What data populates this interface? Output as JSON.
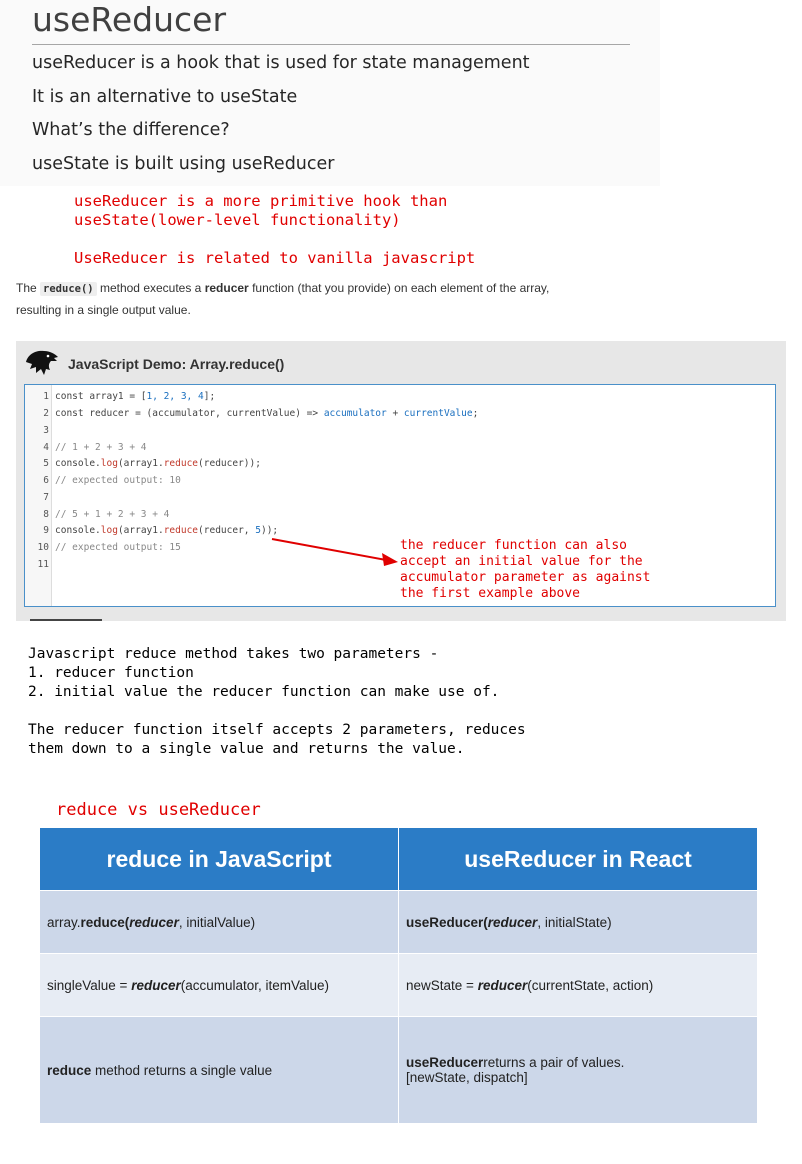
{
  "slide": {
    "title": "useReducer",
    "lines": [
      "useReducer is a hook that is used for state management",
      "It is an alternative to useState",
      "What’s the difference?",
      "useState is built using useReducer"
    ]
  },
  "red_notes": {
    "primitive_line1": "useReducer is a more primitive hook than",
    "primitive_line2": "useState(lower-level functionality)",
    "vanilla": "UseReducer is related to vanilla javascript"
  },
  "mdn": {
    "line1_the": "The",
    "line1_code": "reduce()",
    "line1_mid": "method executes a",
    "line1_bold": "reducer",
    "line1_end": "function (that you provide) on each element of the array,",
    "line2": "resulting in a single output value."
  },
  "demo": {
    "title": "JavaScript Demo: Array.reduce()",
    "line_numbers": [
      "1",
      "2",
      "3",
      "4",
      "5",
      "6",
      "7",
      "8",
      "9",
      "10",
      "11"
    ],
    "code": {
      "l1_a": "const array1 = [",
      "l1_nums": "1, 2, 3, 4",
      "l1_b": "];",
      "l2_a": "const reducer = (accumulator, currentValue) => ",
      "l2_b": "accumulator",
      "l2_c": " + ",
      "l2_d": "currentValue",
      "l2_e": ";",
      "l4": "// 1 + 2 + 3 + 4",
      "l5_a": "console.",
      "l5_b": "log",
      "l5_c": "(array1.",
      "l5_d": "reduce",
      "l5_e": "(reducer));",
      "l6": "// expected output: 10",
      "l8": "// 5 + 1 + 2 + 3 + 4",
      "l9_a": "console.",
      "l9_b": "log",
      "l9_c": "(array1.",
      "l9_d": "reduce",
      "l9_e": "(reducer, ",
      "l9_f": "5",
      "l9_g": "));",
      "l10": "// expected output: 15"
    },
    "annotation": [
      "the reducer function can also",
      "accept an initial value for the",
      "accumulator parameter as against",
      "the first example above"
    ]
  },
  "notes": {
    "l1": "Javascript reduce method takes two parameters -",
    "l2": "1. reducer function",
    "l3": "2. initial value the reducer function can make use of.",
    "l4": "The reducer function itself accepts 2 parameters, reduces",
    "l5": "them down to a single value and returns the value."
  },
  "comparison": {
    "heading": "reduce vs useReducer",
    "col1": "reduce in JavaScript",
    "col2": "useReducer in React",
    "r1c1": {
      "a": "array.",
      "b": "reduce(",
      "c": "reducer",
      "d": ", initialValue)"
    },
    "r1c2": {
      "a": "useReducer(",
      "b": "reducer",
      "c": ", initialState)"
    },
    "r2c1": {
      "a": "singleValue = ",
      "b": "reducer",
      "c": "(accumulator, itemValue)"
    },
    "r2c2": {
      "a": "newState = ",
      "b": "reducer",
      "c": "(currentState, action)"
    },
    "r3c1": {
      "a": "reduce",
      "b": " method returns a single value"
    },
    "r3c2": {
      "a": "useReducer",
      "b": "returns a pair of values.",
      "c": "[newState, dispatch]"
    }
  },
  "colors": {
    "red_text": "#e00000",
    "table_header": "#2b7cc6",
    "row_dark": "#ccd7e9",
    "row_light": "#e7ecf4"
  }
}
